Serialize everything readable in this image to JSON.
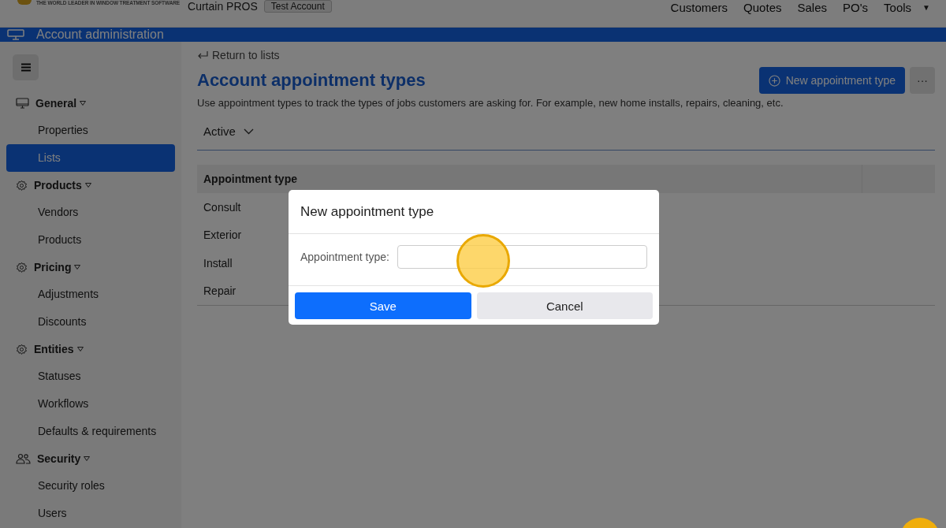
{
  "app": {
    "logo_tagline": "THE WORLD LEADER IN WINDOW TREATMENT SOFTWARE",
    "company": "Curtain PROS",
    "account_badge": "Test Account"
  },
  "nav": [
    {
      "label": "Customers"
    },
    {
      "label": "Quotes"
    },
    {
      "label": "Sales"
    },
    {
      "label": "PO's"
    },
    {
      "label": "Tools",
      "caret": "▼"
    }
  ],
  "header": {
    "title": "Account administration"
  },
  "sidebar": {
    "sections": [
      {
        "label": "General",
        "expanded": true,
        "items": [
          {
            "label": "Properties",
            "selected": false
          },
          {
            "label": "Lists",
            "selected": true
          }
        ]
      },
      {
        "label": "Products",
        "expanded": true,
        "items": [
          {
            "label": "Vendors",
            "selected": false
          },
          {
            "label": "Products",
            "selected": false
          }
        ]
      },
      {
        "label": "Pricing",
        "expanded": true,
        "items": [
          {
            "label": "Adjustments",
            "selected": false
          },
          {
            "label": "Discounts",
            "selected": false
          }
        ]
      },
      {
        "label": "Entities",
        "expanded": true,
        "items": [
          {
            "label": "Statuses",
            "selected": false
          },
          {
            "label": "Workflows",
            "selected": false
          },
          {
            "label": "Defaults & requirements",
            "selected": false
          }
        ]
      },
      {
        "label": "Security",
        "expanded": true,
        "items": [
          {
            "label": "Security roles",
            "selected": false
          },
          {
            "label": "Users",
            "selected": false
          }
        ]
      }
    ]
  },
  "page": {
    "back_link": "Return to lists",
    "title": "Account appointment types",
    "description": "Use appointment types to track the types of jobs customers are asking for. For example, new home installs, repairs, cleaning, etc.",
    "new_button": "New appointment type",
    "more_button": "···",
    "filter": "Active",
    "table": {
      "columns": [
        "Appointment type"
      ],
      "rows": [
        "Consult",
        "Exterior",
        "Install",
        "Repair"
      ]
    }
  },
  "dialog": {
    "title": "New appointment type",
    "field_label": "Appointment type:",
    "save_button": "Save",
    "cancel_button": "Cancel"
  }
}
